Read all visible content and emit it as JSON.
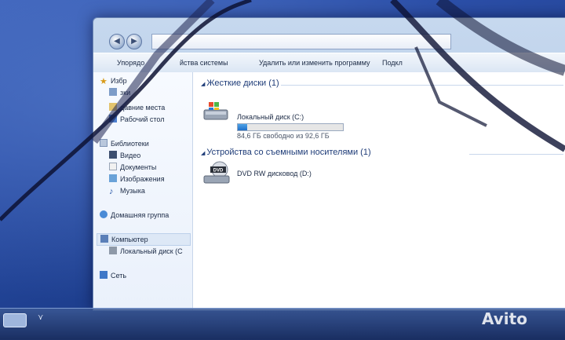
{
  "colors": {
    "accent": "#1f6fc9",
    "window": "#aac3e3",
    "desktop": "#2c4fa8"
  },
  "titlebar": {
    "back_icon": "back-arrow-icon",
    "forward_icon": "forward-arrow-icon"
  },
  "toolbar": {
    "organize": "Упорядо",
    "system_properties": "йства системы",
    "uninstall": "Удалить или изменить программу",
    "open_control_panel": "Подкл"
  },
  "sidebar": {
    "favorites": "Избр",
    "downloads": "зки",
    "recent_places": "давние места",
    "desktop": "Рабочий стол",
    "libraries": "Библиотеки",
    "video": "Видео",
    "documents": "Документы",
    "images": "Изображения",
    "music": "Музыка",
    "homegroup": "Домашняя группа",
    "computer": "Компьютер",
    "local_disk": "Локальный диск (C",
    "network": "Сеть"
  },
  "groups": {
    "hard_disks": {
      "header": "Жесткие диски (1)"
    },
    "removable": {
      "header": "Устройства со съемными носителями (1)"
    }
  },
  "drives": {
    "c": {
      "name": "Локальный диск (C:)",
      "free_text": "84,6 ГБ свободно из 92,6 ГБ",
      "used_fraction": 0.086
    },
    "dvd": {
      "name": "DVD RW дисковод (D:)",
      "badge": "DVD"
    }
  },
  "watermark": "Avito"
}
